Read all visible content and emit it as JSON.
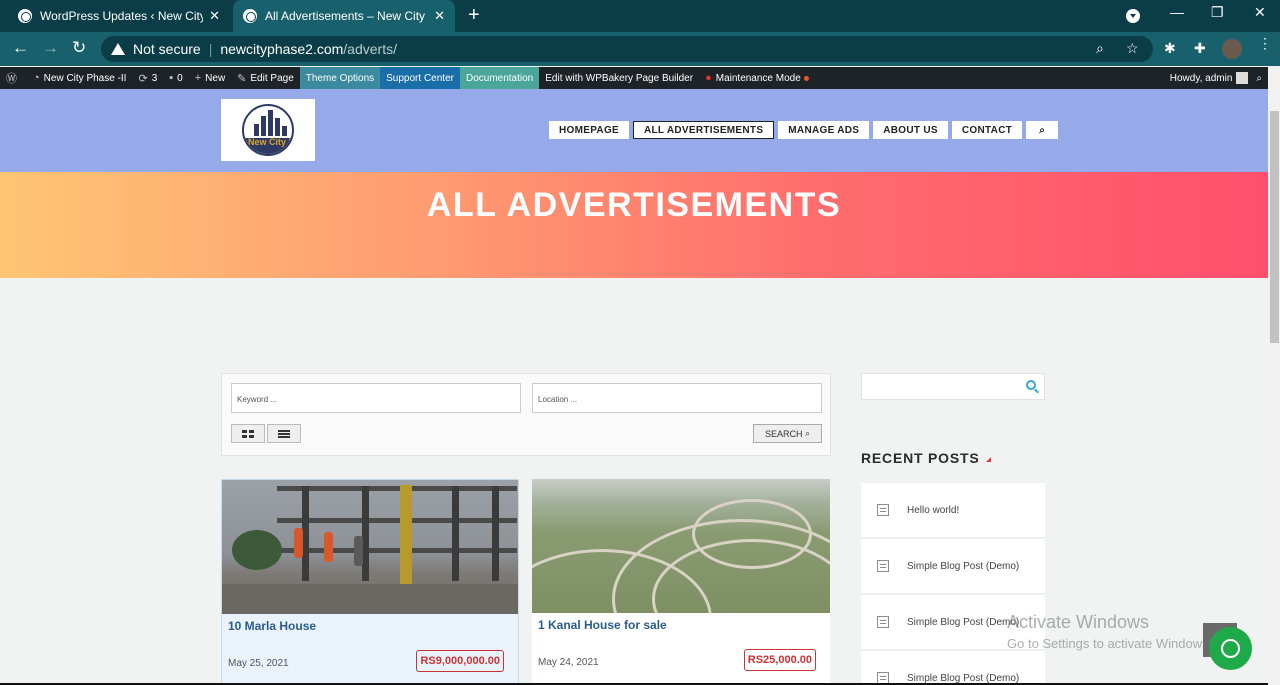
{
  "browser": {
    "tabs": [
      {
        "title": "WordPress Updates ‹ New City Phase -II",
        "active": false
      },
      {
        "title": "All Advertisements – New City Phase -II",
        "active": true
      }
    ],
    "new_tab": "+",
    "security": "Not secure",
    "url_host": "newcityphase2.com",
    "url_path": "/adverts/"
  },
  "admin_bar": {
    "site": "New City Phase -II",
    "updates": "3",
    "comments": "0",
    "new": "New",
    "edit_page": "Edit Page",
    "theme_options": "Theme Options",
    "support_center": "Support Center",
    "documentation": "Documentation",
    "wpbakery": "Edit with WPBakery Page Builder",
    "maintenance": "Maintenance Mode",
    "howdy": "Howdy, admin"
  },
  "site": {
    "logo_text": "New City Phase 2",
    "menu": [
      "HOMEPAGE",
      "ALL ADVERTISEMENTS",
      "MANAGE ADS",
      "ABOUT US",
      "CONTACT"
    ],
    "active_menu": "ALL ADVERTISEMENTS"
  },
  "hero": {
    "title": "ALL ADVERTISEMENTS"
  },
  "search": {
    "keyword_placeholder": "Keyword ...",
    "location_placeholder": "Location ...",
    "search_label": "SEARCH"
  },
  "listings": [
    {
      "title": "10 Marla House",
      "date": "May 25, 2021",
      "price": "RS9,000,000.00"
    },
    {
      "title": "1 Kanal House for sale",
      "date": "May 24, 2021",
      "price": "RS25,000.00"
    }
  ],
  "sidebar": {
    "recent_posts_title": "RECENT POSTS",
    "posts": [
      "Hello world!",
      "Simple Blog Post (Demo)",
      "Simple Blog Post (Demo)",
      "Simple Blog Post (Demo)"
    ]
  },
  "watermark": {
    "line1": "Activate Windows",
    "line2": "Go to Settings to activate Windows."
  },
  "colors": {
    "header_bg": "#96aaea",
    "hero_start": "#ffc574",
    "hero_end": "#ff4f6d",
    "price_red": "#cc3333",
    "chat_green": "#1faa4a"
  }
}
